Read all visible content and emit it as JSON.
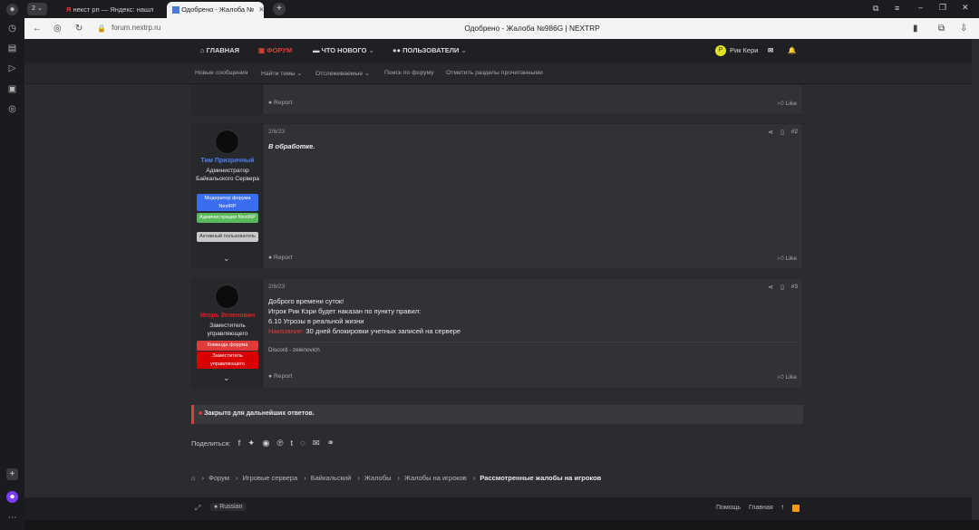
{
  "browser": {
    "tab_count": "2",
    "tabs": [
      {
        "label": "некст рп — Яндекс: нашл",
        "icon": "yandex-icon"
      },
      {
        "label": "Одобрено - Жалоба №",
        "icon": "forum-favicon"
      }
    ],
    "address": "forum.nextrp.ru",
    "page_title": "Одобрено - Жалоба №986G | NEXTRP"
  },
  "nav": {
    "home": "ГЛАВНАЯ",
    "forum": "ФОРУМ",
    "whats_new": "ЧТО НОВОГО",
    "users": "ПОЛЬЗОВАТЕЛИ",
    "user_initial": "Р",
    "user_name": "Рик Кери",
    "sub": [
      "Новые сообщения",
      "Найти темы",
      "Отслеживаемые",
      "Поиск по форуму",
      "Отметить разделы прочитанными"
    ]
  },
  "top_post": {
    "report": "Report",
    "like": "Like"
  },
  "posts": [
    {
      "user": "Тим Призрачный",
      "user_color": "#4f7ff0",
      "title": "Администратор Байкальского Сервера",
      "badges": [
        {
          "label": "Модератор форума NextRP",
          "color": "#3a6df0"
        },
        {
          "label": "Администрация NextRP",
          "color": "#5cb85c"
        },
        {
          "label": "Активный пользователь",
          "color": "#c9c9c9"
        }
      ],
      "date": "2/6/23",
      "number": "#2",
      "text": "В обработке.",
      "report": "Report",
      "like": "Like"
    },
    {
      "user": "Игорь Зеленович",
      "user_color": "#e02020",
      "title": "Заместитель управляющего",
      "badges": [
        {
          "label": "Команда форума",
          "color": "#e03b3b"
        },
        {
          "label": "Заместитель управляющего",
          "color": "#d90000"
        }
      ],
      "date": "2/6/23",
      "number": "#3",
      "lines": [
        "Доброго времени суток!",
        "Игрок Рик Кэри будет наказан по пункту правил:",
        "6.10 Угрозы в реальной жизни"
      ],
      "punish_label": "Наказание:",
      "punish_text": " 30 дней блокировки учетных записей на сервере",
      "signature": "Discord - zelenovich",
      "report": "Report",
      "like": "Like"
    }
  ],
  "closed_notice": "Закрыто для дальнейших ответов.",
  "share_label": "Поделиться:",
  "share_icons": [
    "facebook-icon",
    "twitter-icon",
    "reddit-icon",
    "pinterest-icon",
    "tumblr-icon",
    "whatsapp-icon",
    "email-icon",
    "link-icon"
  ],
  "breadcrumb": [
    "Форум",
    "Игровые сервера",
    "Байкальский",
    "Жалобы",
    "Жалобы на игроков",
    "Рассмотренные жалобы на игроков"
  ],
  "footer": {
    "language": "Russian",
    "help": "Помощь",
    "home": "Главная"
  }
}
